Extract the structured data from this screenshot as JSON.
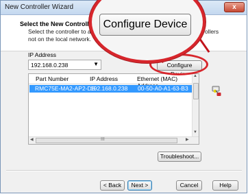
{
  "window": {
    "title": "New Controller Wizard",
    "close_glyph": "x"
  },
  "header": {
    "title": "Select the New Controller",
    "subtitle_line1": "Select the controller to add",
    "subtitle_right": "rollers",
    "subtitle_line2": "not on the local network."
  },
  "ip": {
    "label": "IP Address",
    "value": "192.168.0.238"
  },
  "configure_small_label": "Configure Device",
  "configure_zoom_label": "Configure Device",
  "table": {
    "columns": [
      "Part Number",
      "IP Address",
      "Ethernet (MAC) Address"
    ],
    "rows": [
      [
        "RMC75E-MA2-AP2-D8",
        "192.168.0.238",
        "00-50-A0-A1-63-B3"
      ]
    ],
    "scroll_grip": "III"
  },
  "buttons": {
    "troubleshoot": "Troubleshoot...",
    "back": "< Back",
    "next": "Next >",
    "cancel": "Cancel",
    "help": "Help"
  },
  "colors": {
    "highlight": "#3399ff",
    "annotation_red": "#d7262c"
  },
  "icons": [
    "close-icon",
    "dropdown-arrow-icon",
    "network-plug-icon"
  ]
}
